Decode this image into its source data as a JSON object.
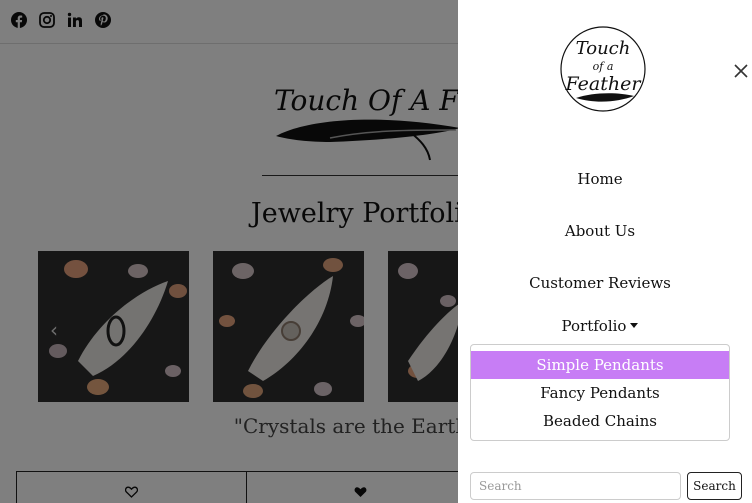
{
  "site": {
    "logo_text": "Touch Of A Feather",
    "social": [
      {
        "icon": "facebook-icon"
      },
      {
        "icon": "instagram-icon"
      },
      {
        "icon": "linkedin-icon"
      },
      {
        "icon": "pinterest-icon"
      }
    ]
  },
  "main": {
    "title": "Jewelry Portfolio",
    "quote": "\"Crystals are the Earth's a",
    "like_icons": [
      "heart-outline-icon",
      "heart-filled-icon"
    ]
  },
  "drawer": {
    "logo_text": "Touch of a Feather",
    "nav": {
      "home": "Home",
      "about": "About Us",
      "reviews": "Customer Reviews",
      "portfolio": "Portfolio"
    },
    "dropdown": [
      {
        "label": "Simple Pendants",
        "active": true
      },
      {
        "label": "Fancy Pendants",
        "active": false
      },
      {
        "label": "Beaded Chains",
        "active": false
      }
    ],
    "search": {
      "placeholder": "Search",
      "value": "",
      "button": "Search"
    }
  },
  "colors": {
    "active_item": "#c77df5",
    "overlay": "rgba(0,0,0,0.5)"
  }
}
